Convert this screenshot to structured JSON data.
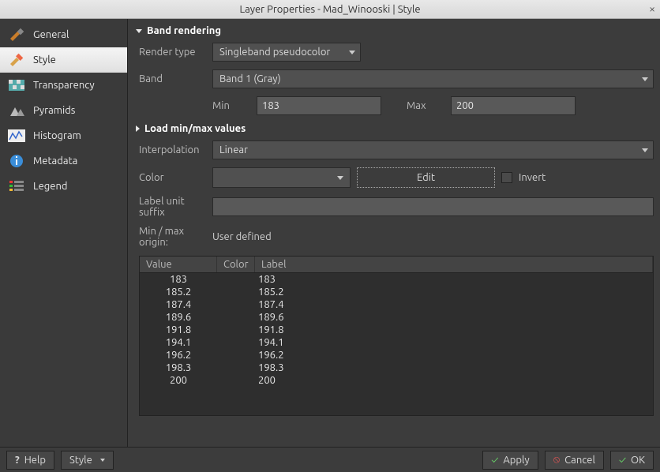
{
  "window": {
    "title": "Layer Properties - Mad_Winooski | Style"
  },
  "sidebar": {
    "items": [
      {
        "label": "General"
      },
      {
        "label": "Style"
      },
      {
        "label": "Transparency"
      },
      {
        "label": "Pyramids"
      },
      {
        "label": "Histogram"
      },
      {
        "label": "Metadata"
      },
      {
        "label": "Legend"
      }
    ],
    "active_index": 1
  },
  "main": {
    "section_band_rendering": "Band rendering",
    "render_type_label": "Render type",
    "render_type_value": "Singleband pseudocolor",
    "band_label": "Band",
    "band_value": "Band 1 (Gray)",
    "min_label": "Min",
    "min_value": "183",
    "max_label": "Max",
    "max_value": "200",
    "section_load": "Load min/max values",
    "interp_label": "Interpolation",
    "interp_value": "Linear",
    "color_label": "Color",
    "edit_label": "Edit",
    "invert_label": "Invert",
    "labelunit_label": "Label unit suffix",
    "labelunit_value": "",
    "minmaxorigin_label": "Min / max origin:",
    "minmaxorigin_value": "User defined",
    "table": {
      "headers": {
        "value": "Value",
        "color": "Color",
        "label": "Label"
      }
    }
  },
  "chart_data": {
    "type": "table",
    "columns": [
      "Value",
      "Color",
      "Label"
    ],
    "rows": [
      {
        "value": "183",
        "label": "183"
      },
      {
        "value": "185.2",
        "label": "185.2"
      },
      {
        "value": "187.4",
        "label": "187.4"
      },
      {
        "value": "189.6",
        "label": "189.6"
      },
      {
        "value": "191.8",
        "label": "191.8"
      },
      {
        "value": "194.1",
        "label": "194.1"
      },
      {
        "value": "196.2",
        "label": "196.2"
      },
      {
        "value": "198.3",
        "label": "198.3"
      },
      {
        "value": "200",
        "label": "200"
      }
    ]
  },
  "footer": {
    "help": "Help",
    "style": "Style",
    "apply": "Apply",
    "cancel": "Cancel",
    "ok": "OK"
  }
}
